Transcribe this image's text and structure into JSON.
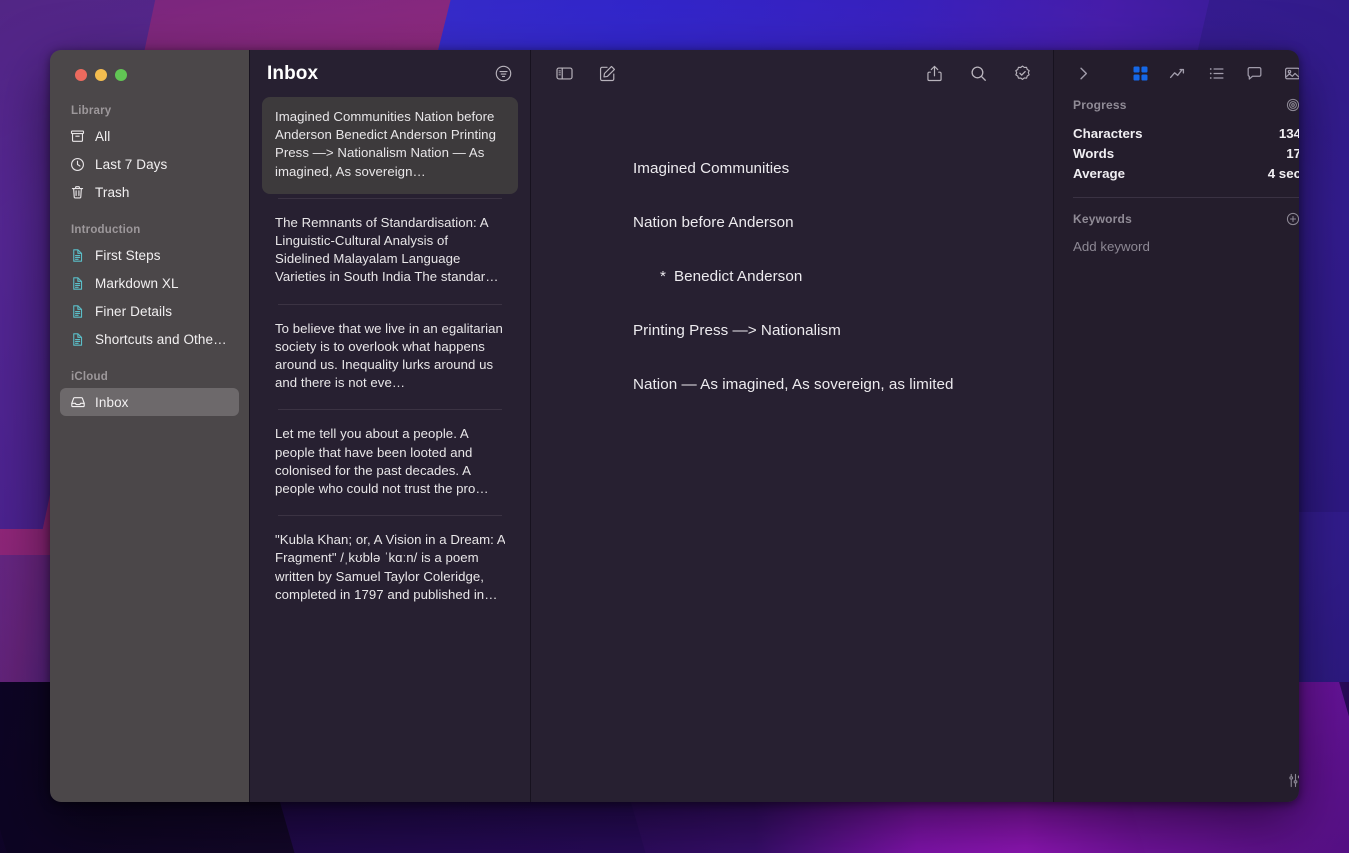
{
  "window": {
    "traffic_lights": [
      "close",
      "minimize",
      "zoom"
    ],
    "colors": {
      "sidebar_bg": "#4b4749",
      "panel_bg": "#272031",
      "inspector_bg": "#241d2c",
      "selected_card": "#3d3a3c",
      "accent_blue": "#1568e8",
      "doc_icon_teal": "#5bbec8",
      "close_red": "#ec6a5e",
      "min_yellow": "#f4bd4f",
      "zoom_green": "#61c554"
    }
  },
  "sidebar": {
    "groups": [
      {
        "title": "Library",
        "items": [
          {
            "label": "All",
            "icon": "archivebox-icon",
            "selected": false
          },
          {
            "label": "Last 7 Days",
            "icon": "clock-icon",
            "selected": false
          },
          {
            "label": "Trash",
            "icon": "trash-icon",
            "selected": false
          }
        ]
      },
      {
        "title": "Introduction",
        "items": [
          {
            "label": "First Steps",
            "icon": "document-icon",
            "selected": false
          },
          {
            "label": "Markdown XL",
            "icon": "document-icon",
            "selected": false
          },
          {
            "label": "Finer Details",
            "icon": "document-icon",
            "selected": false
          },
          {
            "label": "Shortcuts and Other…",
            "icon": "document-icon",
            "selected": false
          }
        ]
      },
      {
        "title": "iCloud",
        "items": [
          {
            "label": "Inbox",
            "icon": "inbox-tray-icon",
            "selected": true
          }
        ]
      }
    ]
  },
  "list_panel": {
    "title": "Inbox",
    "filter_icon": "filter-circle-icon",
    "notes": [
      {
        "preview": "Imagined Communities Nation before Anderson Benedict Anderson Printing Press —> Nationalism Nation — As imagined, As sovereign…",
        "selected": true
      },
      {
        "preview": "The Remnants of Standardisation: A Linguistic-Cultural Analysis of Sidelined Malayalam Language Varieties in South India The standar…",
        "selected": false
      },
      {
        "preview": "To believe that we live in an egalitarian society is to overlook what happens around us. Inequality lurks around us and there is not eve…",
        "selected": false
      },
      {
        "preview": "Let me tell you about a people. A people that have been looted and colonised for the past decades. A people who could not trust the pro…",
        "selected": false
      },
      {
        "preview": "\"Kubla Khan; or, A Vision in a Dream: A Fragment\" /ˌkʊblə ˈkɑːn/ is a poem written by Samuel Taylor Coleridge, completed in 1797 and published in…",
        "selected": false
      }
    ]
  },
  "editor": {
    "toolbar_left": [
      {
        "name": "toggle-sidebar-icon",
        "label": "Toggle Sidebar"
      },
      {
        "name": "compose-icon",
        "label": "New Note"
      }
    ],
    "toolbar_right": [
      {
        "name": "share-icon",
        "label": "Share"
      },
      {
        "name": "search-icon",
        "label": "Search"
      },
      {
        "name": "checkmark-seal-icon",
        "label": "Check"
      }
    ],
    "lines": [
      {
        "text": "Imagined Communities",
        "type": "paragraph"
      },
      {
        "text": "Nation before Anderson",
        "type": "paragraph"
      },
      {
        "text": "Benedict Anderson",
        "type": "bullet",
        "marker": "*"
      },
      {
        "text": "Printing Press —> Nationalism",
        "type": "paragraph"
      },
      {
        "text": "Nation — As imagined, As sovereign, as limited",
        "type": "paragraph"
      }
    ]
  },
  "inspector": {
    "chevron_icon": "chevron-right-icon",
    "tabs": [
      {
        "name": "grid-icon",
        "label": "Overview",
        "active": true
      },
      {
        "name": "chart-line-icon",
        "label": "Statistics",
        "active": false
      },
      {
        "name": "list-icon",
        "label": "Outline",
        "active": false
      },
      {
        "name": "comment-icon",
        "label": "Comments",
        "active": false
      },
      {
        "name": "image-icon",
        "label": "Media",
        "active": false
      }
    ],
    "progress": {
      "title": "Progress",
      "target_icon": "target-icon",
      "stats": [
        {
          "label": "Characters",
          "value": "134"
        },
        {
          "label": "Words",
          "value": "17"
        },
        {
          "label": "Average",
          "value": "4 sec"
        }
      ]
    },
    "keywords": {
      "title": "Keywords",
      "add_icon": "plus-circle-icon",
      "placeholder": "Add keyword"
    },
    "footer_icon": "sliders-icon"
  }
}
